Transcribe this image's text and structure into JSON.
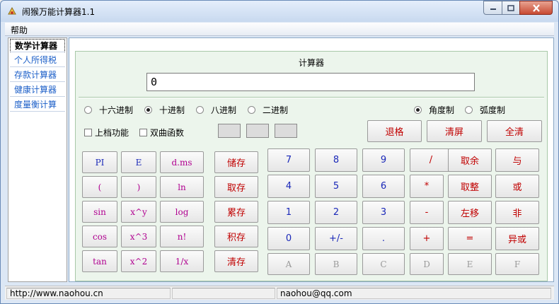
{
  "window": {
    "title": "闹猴万能计算器1.1"
  },
  "menu": {
    "help": "帮助"
  },
  "sidebar": {
    "items": [
      {
        "label": "数学计算器"
      },
      {
        "label": "个人所得税"
      },
      {
        "label": "存款计算器"
      },
      {
        "label": "健康计算器"
      },
      {
        "label": "度量衡计算"
      }
    ]
  },
  "calculator": {
    "title": "计算器",
    "display": "0",
    "bases": [
      "十六进制",
      "十进制",
      "八进制",
      "二进制"
    ],
    "selected_base": "十进制",
    "angle_modes": [
      "角度制",
      "弧度制"
    ],
    "selected_angle": "角度制",
    "checkboxes": [
      "上档功能",
      "双曲函数"
    ],
    "action_buttons": [
      "退格",
      "清屏",
      "全清"
    ],
    "func_buttons": [
      [
        "PI",
        "E",
        "d.ms"
      ],
      [
        "(",
        ")",
        "ln"
      ],
      [
        "sin",
        "x^y",
        "log"
      ],
      [
        "cos",
        "x^3",
        "n!"
      ],
      [
        "tan",
        "x^2",
        "1/x"
      ]
    ],
    "memory_buttons": [
      "储存",
      "取存",
      "累存",
      "积存",
      "清存"
    ],
    "pad_buttons": [
      [
        "7",
        "8",
        "9",
        "/",
        "取余",
        "与"
      ],
      [
        "4",
        "5",
        "6",
        "*",
        "取整",
        "或"
      ],
      [
        "1",
        "2",
        "3",
        "-",
        "左移",
        "非"
      ],
      [
        "0",
        "+/-",
        ".",
        "+",
        "=",
        "异或"
      ],
      [
        "A",
        "B",
        "C",
        "D",
        "E",
        "F"
      ]
    ]
  },
  "status": {
    "website": "http://www.naohou.cn",
    "email": "naohou@qq.com"
  }
}
